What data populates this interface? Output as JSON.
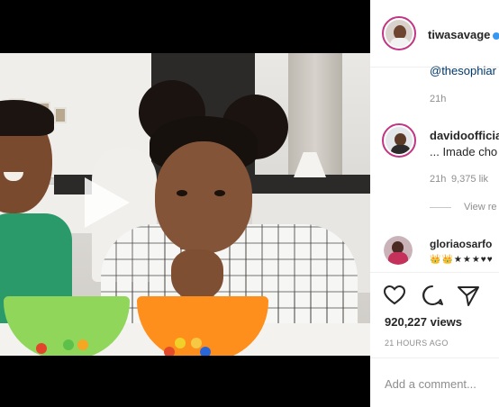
{
  "video": {
    "play_icon": "play-icon"
  },
  "post": {
    "author": "tiwasavage",
    "verified": true,
    "caption_mention": "@thesophiar",
    "caption_time": "21h"
  },
  "comments": [
    {
      "username": "davidoofficial",
      "text": "... Imade cho",
      "time": "21h",
      "likes": "9,375 lik",
      "view_replies": "View re"
    },
    {
      "username": "gloriaosarfo",
      "emojis": "👑👑★★★♥♥"
    }
  ],
  "actions": {
    "like_icon": "heart-icon",
    "comment_icon": "comment-icon",
    "share_icon": "share-icon"
  },
  "stats": {
    "views": "920,227 views",
    "posted": "21 HOURS AGO"
  },
  "comment_box": {
    "placeholder": "Add a comment..."
  },
  "colors": {
    "accent_link": "#00376b",
    "verified_blue": "#3897f0",
    "muted": "#8e8e8e"
  }
}
